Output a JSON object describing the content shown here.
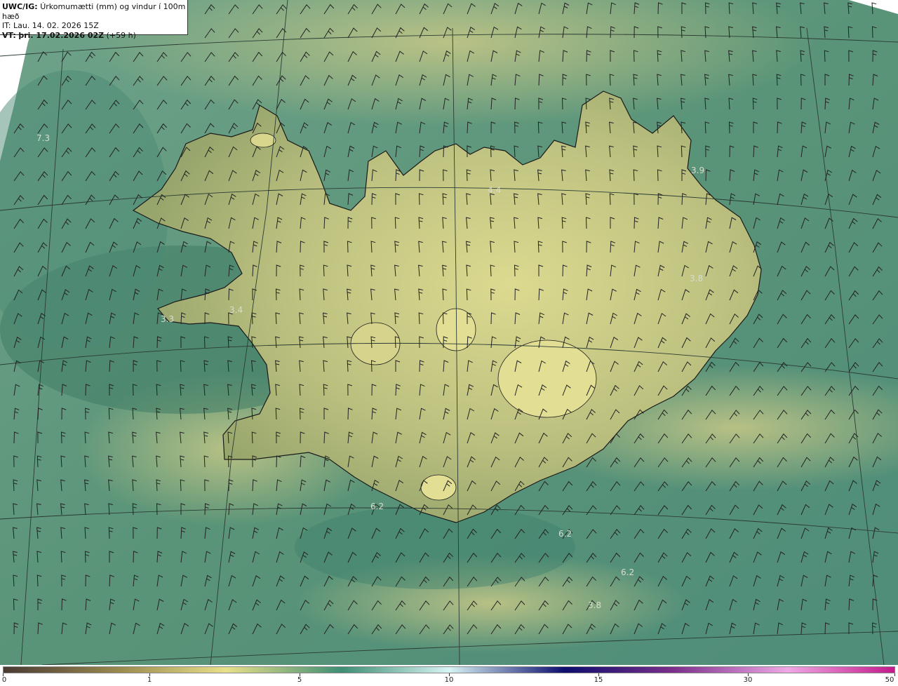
{
  "header": {
    "model": "UWC/IG:",
    "title": "Úrkomumætti (mm) og vindur í 100m hæð",
    "init_prefix": "IT:",
    "init_time": "Lau. 14. 02. 2026 15Z",
    "valid_prefix": "VT:",
    "valid_time": "þri. 17.02.2026 02Z",
    "lead": "(+59 h)"
  },
  "value_labels": [
    {
      "text": "7.3"
    },
    {
      "text": "3.4"
    },
    {
      "text": "3.3"
    },
    {
      "text": "4.4"
    },
    {
      "text": "3.9"
    },
    {
      "text": "3.8"
    },
    {
      "text": "6.2"
    },
    {
      "text": "6.2"
    },
    {
      "text": "6.2"
    },
    {
      "text": "3.8"
    }
  ],
  "legend": {
    "ticks": [
      "0",
      "1",
      "5",
      "10",
      "15",
      "30",
      "50"
    ],
    "colors": [
      "#4a3a33",
      "#9b8a4e",
      "#e8e08a",
      "#3f8e74",
      "#d8f4f4",
      "#0d0d6e",
      "#7a2e8a",
      "#f0a8e6",
      "#c21a8a"
    ]
  },
  "map_colors": {
    "sea": "#5f9a84",
    "land": "#b5b877",
    "land_high": "#d9d88c",
    "coast": "#1a1a1a",
    "barb": "#222222"
  }
}
